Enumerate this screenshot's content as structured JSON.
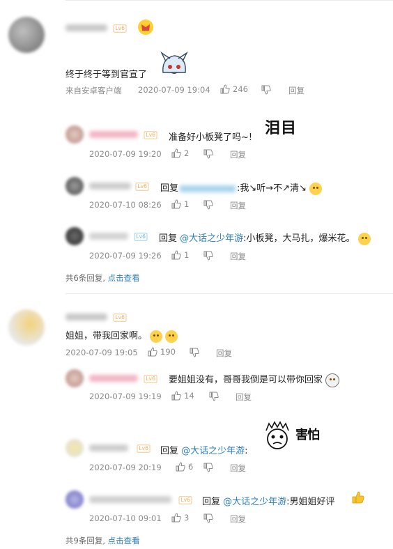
{
  "comments": [
    {
      "text": "终于终于等到官宣了",
      "source": "来自安卓客户端",
      "time": "2020-07-09 19:04",
      "likes": "246",
      "reply": "回复",
      "replies": [
        {
          "text": "准备好小板凳了吗~!",
          "sticker": "泪目",
          "time": "2020-07-09 19:20",
          "likes": "2",
          "reply": "回复"
        },
        {
          "prefix": "回复",
          "suffix": ":我↘听→不↗清↘",
          "time": "2020-07-10 08:26",
          "likes": "1",
          "reply": "回复"
        },
        {
          "prefix": "回复",
          "mention": "@大话之少年游",
          "suffix": ":小板凳，大马扎，爆米花。",
          "time": "2020-07-09 19:26",
          "likes": "1",
          "reply": "回复"
        }
      ],
      "more_count": "共6条回复,",
      "more_link": "点击查看"
    },
    {
      "text": "姐姐，带我回家啊。",
      "time": "2020-07-09 19:05",
      "likes": "190",
      "reply": "回复",
      "replies": [
        {
          "text": "要姐姐没有，哥哥我倒是可以带你回家",
          "time": "2020-07-09 19:19",
          "likes": "14",
          "reply": "回复"
        },
        {
          "prefix": "回复",
          "mention": "@大话之少年游",
          "suffix": ":",
          "sticker": "害怕",
          "time": "2020-07-09 20:19",
          "likes": "6",
          "reply": "回复"
        },
        {
          "prefix": "回复",
          "mention": "@大话之少年游",
          "suffix": ":男姐姐好评",
          "time": "2020-07-10 09:01",
          "likes": "3",
          "reply": "回复"
        }
      ],
      "more_count": "共9条回复,",
      "more_link": "点击查看"
    }
  ],
  "level_badge": "Lv6",
  "colors": {
    "link": "#2c7ec2",
    "meta": "#8a8a8a",
    "divider": "#ebebeb"
  }
}
